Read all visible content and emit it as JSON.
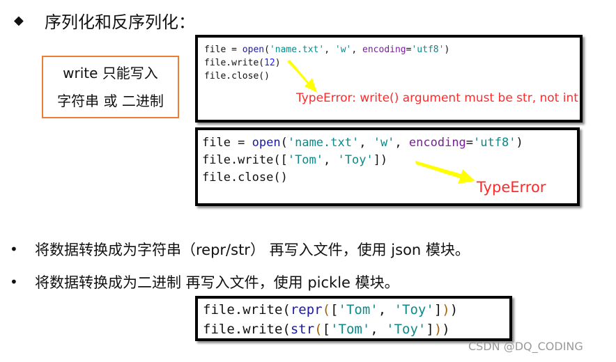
{
  "heading": {
    "bullet_icon": "◆",
    "text": "序列化和反序列化："
  },
  "note_box": {
    "line1": "write 只能写入",
    "line2": "字符串 或 二进制"
  },
  "code_block_1": {
    "lines": [
      [
        {
          "t": "file = "
        },
        {
          "t": "open",
          "c": "kw"
        },
        {
          "t": "("
        },
        {
          "t": "'name.txt'",
          "c": "str"
        },
        {
          "t": ", "
        },
        {
          "t": "'w'",
          "c": "str"
        },
        {
          "t": ", "
        },
        {
          "t": "encoding",
          "c": "param"
        },
        {
          "t": "="
        },
        {
          "t": "'utf8'",
          "c": "str"
        },
        {
          "t": ")"
        }
      ],
      [
        {
          "t": "file.write("
        },
        {
          "t": "12",
          "c": "num"
        },
        {
          "t": ")"
        }
      ],
      [
        {
          "t": "file.close()"
        }
      ]
    ],
    "error": "TypeError: write() argument must be str, not int"
  },
  "code_block_2": {
    "lines": [
      [
        {
          "t": "file = "
        },
        {
          "t": "open",
          "c": "kw"
        },
        {
          "t": "("
        },
        {
          "t": "'name.txt'",
          "c": "str"
        },
        {
          "t": ", "
        },
        {
          "t": "'w'",
          "c": "str"
        },
        {
          "t": ", "
        },
        {
          "t": "encoding",
          "c": "param"
        },
        {
          "t": "="
        },
        {
          "t": "'utf8'",
          "c": "str"
        },
        {
          "t": ")"
        }
      ],
      [
        {
          "t": "file.write(["
        },
        {
          "t": "'Tom'",
          "c": "str"
        },
        {
          "t": ", "
        },
        {
          "t": "'Toy'",
          "c": "str"
        },
        {
          "t": "])"
        }
      ],
      [
        {
          "t": "file.close()"
        }
      ]
    ],
    "error": "TypeError"
  },
  "bullets": [
    {
      "icon": "•",
      "text": "将数据转换成为字符串（repr/str） 再写入文件，使用 json 模块。"
    },
    {
      "icon": "•",
      "text": "将数据转换成为二进制 再写入文件，使用 pickle 模块。"
    }
  ],
  "code_block_3": {
    "lines": [
      [
        {
          "t": "file.write("
        },
        {
          "t": "repr",
          "c": "kw"
        },
        {
          "t": "(",
          "c": "paren"
        },
        {
          "t": "["
        },
        {
          "t": "'Tom'",
          "c": "str"
        },
        {
          "t": ", "
        },
        {
          "t": "'Toy'",
          "c": "str"
        },
        {
          "t": "]"
        },
        {
          "t": ")",
          "c": "paren"
        },
        {
          "t": ")"
        }
      ],
      [
        {
          "t": "file.write("
        },
        {
          "t": "str",
          "c": "kw"
        },
        {
          "t": "(",
          "c": "paren"
        },
        {
          "t": "["
        },
        {
          "t": "'Tom'",
          "c": "str"
        },
        {
          "t": ", "
        },
        {
          "t": "'Toy'",
          "c": "str"
        },
        {
          "t": "]"
        },
        {
          "t": ")",
          "c": "paren"
        },
        {
          "t": ")"
        }
      ]
    ]
  },
  "watermark": "CSDN @DQ_CODING",
  "colors": {
    "accent_border": "#ed7d31",
    "error_text": "#ff2a2a",
    "arrow": "#ffff00"
  }
}
